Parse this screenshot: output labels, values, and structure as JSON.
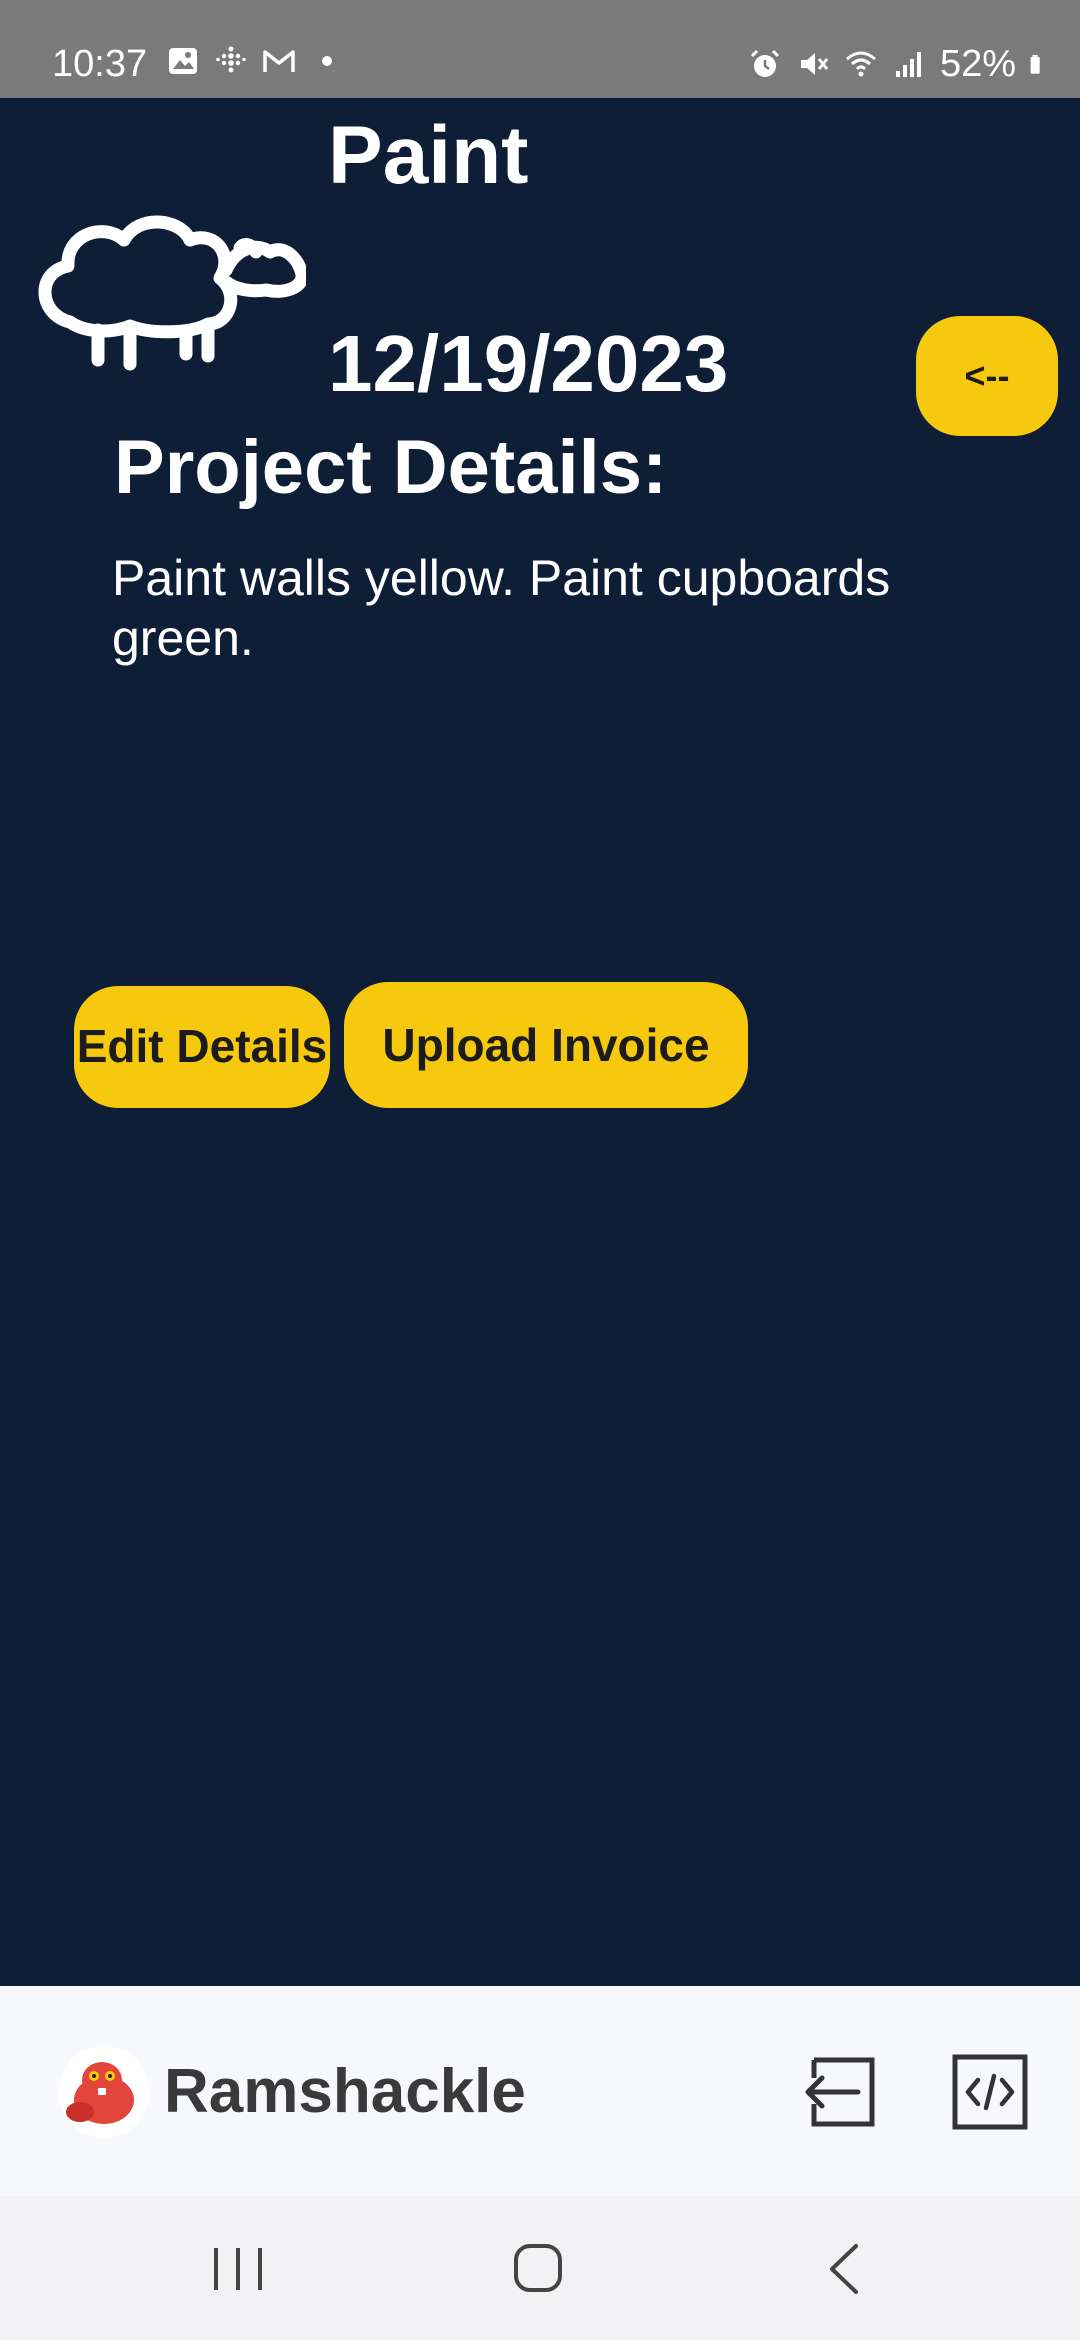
{
  "status_bar": {
    "time": "10:37",
    "left_icons": [
      "image-icon",
      "fitbit-icon",
      "gmail-icon",
      "dot-icon"
    ],
    "right_icons": [
      "alarm-icon",
      "mute-icon",
      "wifi-icon",
      "signal-icon"
    ],
    "battery": "52%"
  },
  "project": {
    "title": "Paint",
    "date": "12/19/2023",
    "back_label": "<--",
    "details_heading": "Project Details:",
    "details_text": "Paint walls yellow. Paint cupboards green."
  },
  "actions": {
    "edit_label": "Edit Details",
    "upload_label": "Upload Invoice"
  },
  "app_bar": {
    "name": "Ramshackle"
  },
  "colors": {
    "background": "#0d1e36",
    "accent": "#f6c90e",
    "status_bar": "#7a7a7a"
  }
}
